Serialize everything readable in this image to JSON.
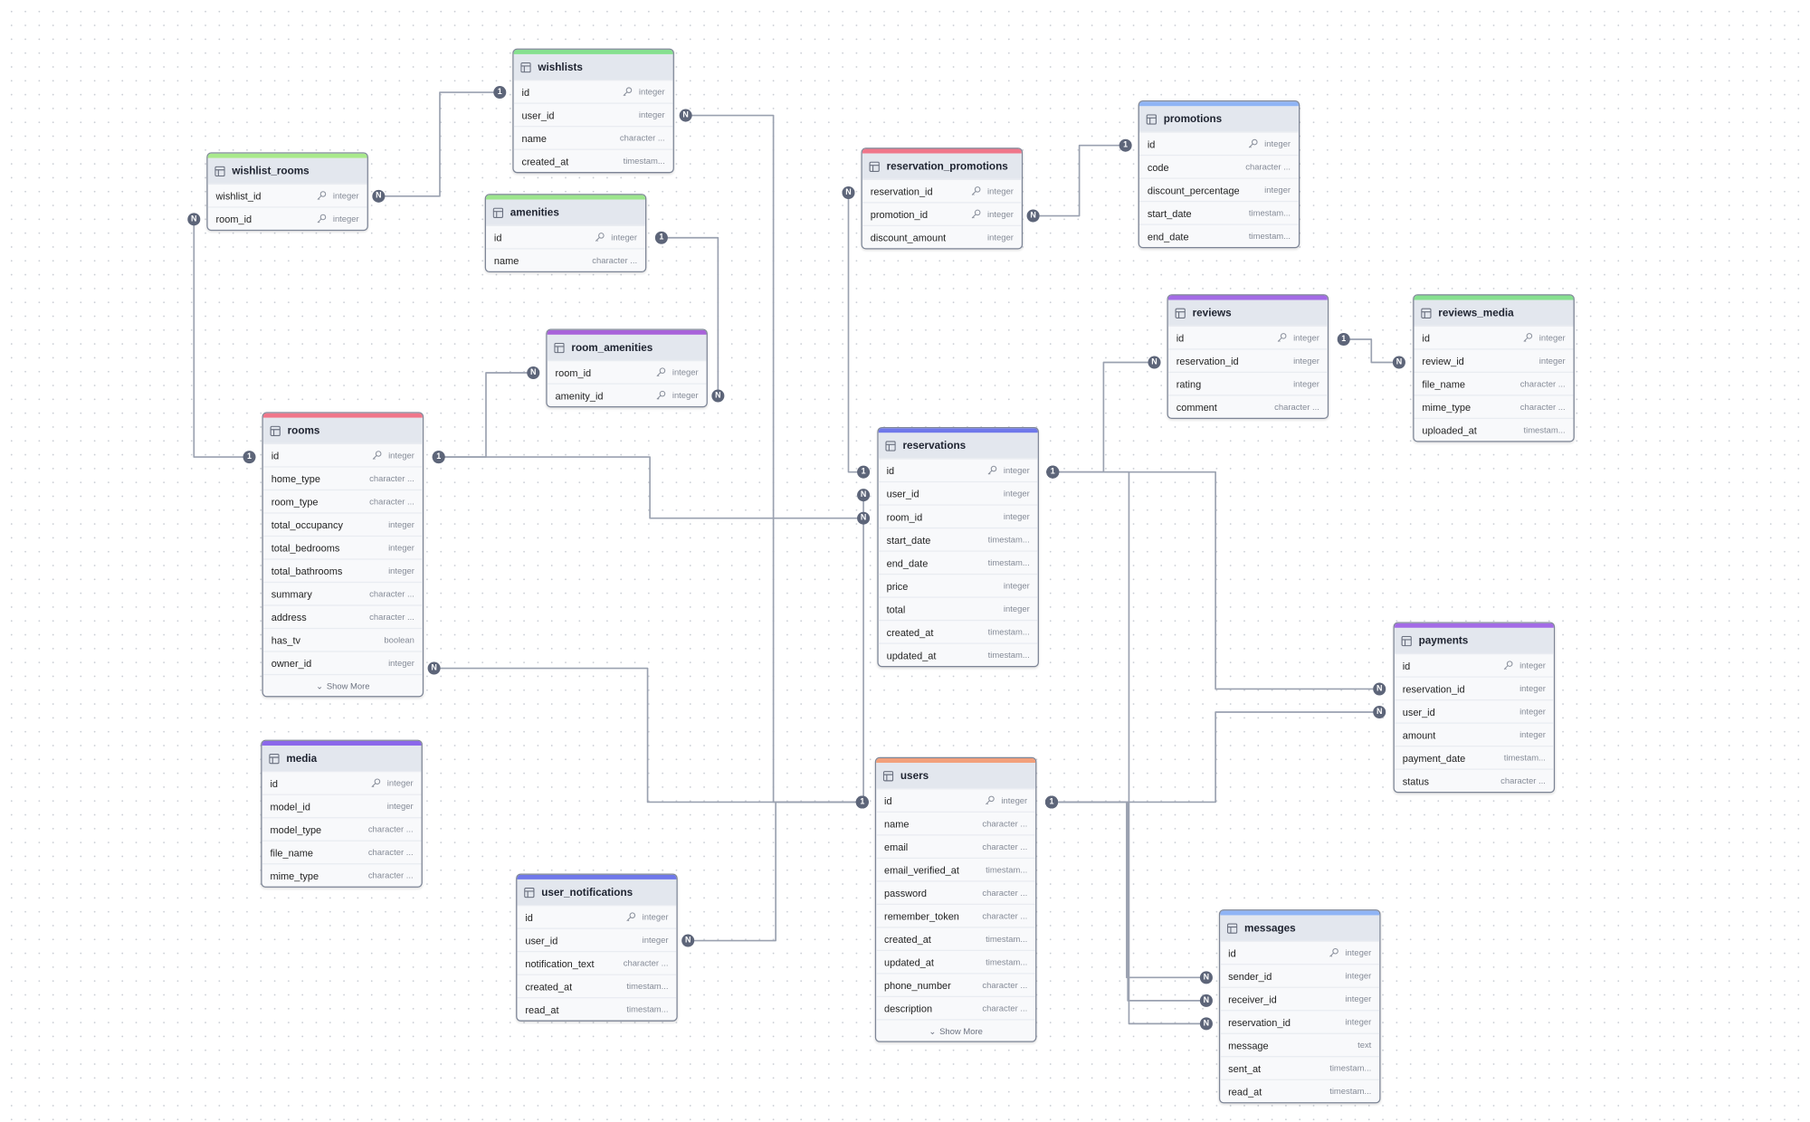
{
  "tables": [
    {
      "name": "wishlists",
      "color": "#86e08f",
      "fields": [
        {
          "name": "id",
          "type": "integer",
          "pk": true
        },
        {
          "name": "user_id",
          "type": "integer"
        },
        {
          "name": "name",
          "type": "character ..."
        },
        {
          "name": "created_at",
          "type": "timestam..."
        }
      ]
    },
    {
      "name": "wishlist_rooms",
      "color": "#a9e98c",
      "fields": [
        {
          "name": "wishlist_id",
          "type": "integer",
          "pk": true
        },
        {
          "name": "room_id",
          "type": "integer",
          "pk": true
        }
      ]
    },
    {
      "name": "amenities",
      "color": "#9ce58d",
      "fields": [
        {
          "name": "id",
          "type": "integer",
          "pk": true
        },
        {
          "name": "name",
          "type": "character ..."
        }
      ]
    },
    {
      "name": "room_amenities",
      "color": "#a862d9",
      "fields": [
        {
          "name": "room_id",
          "type": "integer",
          "pk": true
        },
        {
          "name": "amenity_id",
          "type": "integer",
          "pk": true
        }
      ]
    },
    {
      "name": "rooms",
      "color": "#f0768a",
      "fields": [
        {
          "name": "id",
          "type": "integer",
          "pk": true
        },
        {
          "name": "home_type",
          "type": "character ..."
        },
        {
          "name": "room_type",
          "type": "character ..."
        },
        {
          "name": "total_occupancy",
          "type": "integer"
        },
        {
          "name": "total_bedrooms",
          "type": "integer"
        },
        {
          "name": "total_bathrooms",
          "type": "integer"
        },
        {
          "name": "summary",
          "type": "character ..."
        },
        {
          "name": "address",
          "type": "character ..."
        },
        {
          "name": "has_tv",
          "type": "boolean"
        },
        {
          "name": "owner_id",
          "type": "integer"
        }
      ],
      "show_more": "Show More"
    },
    {
      "name": "media",
      "color": "#8b67ea",
      "fields": [
        {
          "name": "id",
          "type": "integer",
          "pk": true
        },
        {
          "name": "model_id",
          "type": "integer"
        },
        {
          "name": "model_type",
          "type": "character ..."
        },
        {
          "name": "file_name",
          "type": "character ..."
        },
        {
          "name": "mime_type",
          "type": "character ..."
        }
      ]
    },
    {
      "name": "user_notifications",
      "color": "#6f78ea",
      "fields": [
        {
          "name": "id",
          "type": "integer",
          "pk": true
        },
        {
          "name": "user_id",
          "type": "integer"
        },
        {
          "name": "notification_text",
          "type": "character ..."
        },
        {
          "name": "created_at",
          "type": "timestam..."
        },
        {
          "name": "read_at",
          "type": "timestam..."
        }
      ]
    },
    {
      "name": "reservation_promotions",
      "color": "#f0768a",
      "fields": [
        {
          "name": "reservation_id",
          "type": "integer",
          "pk": true
        },
        {
          "name": "promotion_id",
          "type": "integer",
          "pk": true
        },
        {
          "name": "discount_amount",
          "type": "integer"
        }
      ]
    },
    {
      "name": "promotions",
      "color": "#8fb4f5",
      "fields": [
        {
          "name": "id",
          "type": "integer",
          "pk": true
        },
        {
          "name": "code",
          "type": "character ..."
        },
        {
          "name": "discount_percentage",
          "type": "integer"
        },
        {
          "name": "start_date",
          "type": "timestam..."
        },
        {
          "name": "end_date",
          "type": "timestam..."
        }
      ]
    },
    {
      "name": "reviews",
      "color": "#a36be6",
      "fields": [
        {
          "name": "id",
          "type": "integer",
          "pk": true
        },
        {
          "name": "reservation_id",
          "type": "integer"
        },
        {
          "name": "rating",
          "type": "integer"
        },
        {
          "name": "comment",
          "type": "character ..."
        }
      ]
    },
    {
      "name": "reviews_media",
      "color": "#86e08f",
      "fields": [
        {
          "name": "id",
          "type": "integer",
          "pk": true
        },
        {
          "name": "review_id",
          "type": "integer"
        },
        {
          "name": "file_name",
          "type": "character ..."
        },
        {
          "name": "mime_type",
          "type": "character ..."
        },
        {
          "name": "uploaded_at",
          "type": "timestam..."
        }
      ]
    },
    {
      "name": "reservations",
      "color": "#6f78ea",
      "fields": [
        {
          "name": "id",
          "type": "integer",
          "pk": true
        },
        {
          "name": "user_id",
          "type": "integer"
        },
        {
          "name": "room_id",
          "type": "integer"
        },
        {
          "name": "start_date",
          "type": "timestam..."
        },
        {
          "name": "end_date",
          "type": "timestam..."
        },
        {
          "name": "price",
          "type": "integer"
        },
        {
          "name": "total",
          "type": "integer"
        },
        {
          "name": "created_at",
          "type": "timestam..."
        },
        {
          "name": "updated_at",
          "type": "timestam..."
        }
      ]
    },
    {
      "name": "users",
      "color": "#f2a07b",
      "fields": [
        {
          "name": "id",
          "type": "integer",
          "pk": true
        },
        {
          "name": "name",
          "type": "character ..."
        },
        {
          "name": "email",
          "type": "character ..."
        },
        {
          "name": "email_verified_at",
          "type": "timestam..."
        },
        {
          "name": "password",
          "type": "character ..."
        },
        {
          "name": "remember_token",
          "type": "character ..."
        },
        {
          "name": "created_at",
          "type": "timestam..."
        },
        {
          "name": "updated_at",
          "type": "timestam..."
        },
        {
          "name": "phone_number",
          "type": "character ..."
        },
        {
          "name": "description",
          "type": "character ..."
        }
      ],
      "show_more": "Show More"
    },
    {
      "name": "payments",
      "color": "#a36be6",
      "fields": [
        {
          "name": "id",
          "type": "integer",
          "pk": true
        },
        {
          "name": "reservation_id",
          "type": "integer"
        },
        {
          "name": "user_id",
          "type": "integer"
        },
        {
          "name": "amount",
          "type": "integer"
        },
        {
          "name": "payment_date",
          "type": "timestam..."
        },
        {
          "name": "status",
          "type": "character ..."
        }
      ]
    },
    {
      "name": "messages",
      "color": "#8fb4f5",
      "fields": [
        {
          "name": "id",
          "type": "integer",
          "pk": true
        },
        {
          "name": "sender_id",
          "type": "integer"
        },
        {
          "name": "receiver_id",
          "type": "integer"
        },
        {
          "name": "reservation_id",
          "type": "integer"
        },
        {
          "name": "message",
          "type": "text"
        },
        {
          "name": "sent_at",
          "type": "timestam..."
        },
        {
          "name": "read_at",
          "type": "timestam..."
        }
      ]
    }
  ],
  "relations": [
    {
      "from": "wishlist_rooms.wishlist_id",
      "to": "wishlists.id",
      "from_card": "N",
      "to_card": "1"
    },
    {
      "from": "wishlist_rooms.room_id",
      "to": "rooms.id",
      "from_card": "N",
      "to_card": "1"
    },
    {
      "from": "wishlists.user_id",
      "to": "users.id",
      "from_card": "N",
      "to_card": "1"
    },
    {
      "from": "room_amenities.amenity_id",
      "to": "amenities.id",
      "from_card": "N",
      "to_card": "1"
    },
    {
      "from": "room_amenities.room_id",
      "to": "rooms.id",
      "from_card": "N",
      "to_card": "1"
    },
    {
      "from": "reservations.room_id",
      "to": "rooms.id",
      "from_card": "N",
      "to_card": "1"
    },
    {
      "from": "rooms.owner_id",
      "to": "users.id",
      "from_card": "N",
      "to_card": "1"
    },
    {
      "from": "user_notifications.user_id",
      "to": "users.id",
      "from_card": "N",
      "to_card": "1"
    },
    {
      "from": "reservation_promotions.reservation_id",
      "to": "reservations.id",
      "from_card": "N",
      "to_card": "1"
    },
    {
      "from": "reservations.user_id",
      "to": "users.id",
      "from_card": "N",
      "to_card": "1"
    },
    {
      "from": "reservation_promotions.promotion_id",
      "to": "promotions.id",
      "from_card": "N",
      "to_card": "1"
    },
    {
      "from": "reviews.reservation_id",
      "to": "reservations.id",
      "from_card": "N",
      "to_card": "1"
    },
    {
      "from": "payments.reservation_id",
      "to": "reservations.id",
      "from_card": "N",
      "to_card": "1"
    },
    {
      "from": "messages.reservation_id",
      "to": "reservations.id",
      "from_card": "N",
      "to_card": "1"
    },
    {
      "from": "payments.user_id",
      "to": "users.id",
      "from_card": "N",
      "to_card": "1"
    },
    {
      "from": "messages.sender_id",
      "to": "users.id",
      "from_card": "N",
      "to_card": "1"
    },
    {
      "from": "messages.receiver_id",
      "to": "users.id",
      "from_card": "N",
      "to_card": "1"
    },
    {
      "from": "reviews_media.review_id",
      "to": "reviews.id",
      "from_card": "N",
      "to_card": "1"
    }
  ]
}
